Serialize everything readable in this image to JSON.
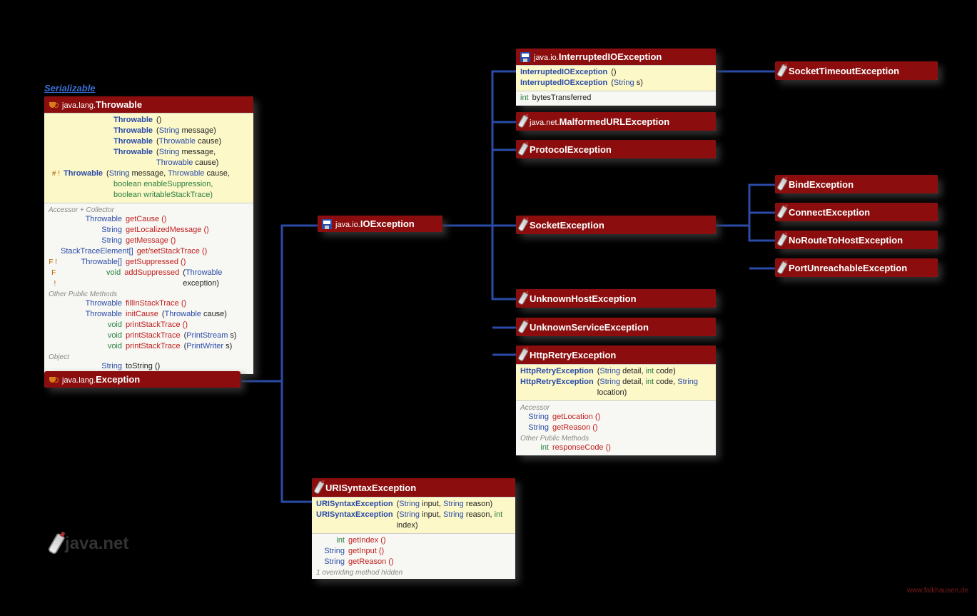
{
  "interfaceLabel": "Serializable",
  "throwable": {
    "pkg": "java.lang.",
    "name": "Throwable",
    "ctors": [
      {
        "name": "Throwable",
        "params": ""
      },
      {
        "name": "Throwable",
        "params": "(String message)"
      },
      {
        "name": "Throwable",
        "params": "(Throwable cause)"
      },
      {
        "name": "Throwable",
        "params": "(String message, Throwable cause)"
      }
    ],
    "protCtor": {
      "mod": "# !",
      "name": "Throwable",
      "p1": "(String message, Throwable cause,",
      "b1": "boolean enableSuppression,",
      "b2": "boolean writableStackTrace)"
    },
    "sec1": "Accessor + Collector",
    "accessors": [
      {
        "ret": "Throwable",
        "m": "getCause ()"
      },
      {
        "ret": "String",
        "m": "getLocalizedMessage ()"
      },
      {
        "ret": "String",
        "m": "getMessage ()"
      },
      {
        "ret": "StackTraceElement[]",
        "m": "get/setStackTrace ()"
      },
      {
        "mod": "F !",
        "ret": "Throwable[]",
        "m": "getSuppressed ()"
      },
      {
        "mod": "F !",
        "ret": "void",
        "m": "addSuppressed (Throwable exception)"
      }
    ],
    "sec2": "Other Public Methods",
    "others": [
      {
        "ret": "Throwable",
        "m": "fillInStackTrace ()"
      },
      {
        "ret": "Throwable",
        "m": "initCause (Throwable cause)"
      },
      {
        "ret": "void",
        "m": "printStackTrace ()"
      },
      {
        "ret": "void",
        "m": "printStackTrace (PrintStream s)"
      },
      {
        "ret": "void",
        "m": "printStackTrace (PrintWriter s)"
      }
    ],
    "sec3": "Object",
    "objm": {
      "ret": "String",
      "m": "toString ()"
    }
  },
  "exception": {
    "pkg": "java.lang.",
    "name": "Exception"
  },
  "ioexception": {
    "pkg": "java.io.",
    "name": "IOException"
  },
  "urisyntax": {
    "name": "URISyntaxException",
    "ctors": [
      {
        "name": "URISyntaxException",
        "p": "(String input, String reason)"
      },
      {
        "name": "URISyntaxException",
        "p": "(String input, String reason, int index)"
      }
    ],
    "acc": [
      {
        "ret": "int",
        "m": "getIndex ()"
      },
      {
        "ret": "String",
        "m": "getInput ()"
      },
      {
        "ret": "String",
        "m": "getReason ()"
      }
    ],
    "note": "1 overriding method hidden"
  },
  "interruptedIO": {
    "pkg": "java.io.",
    "name": "InterruptedIOException",
    "ctors": [
      {
        "name": "InterruptedIOException",
        "p": "()"
      },
      {
        "name": "InterruptedIOException",
        "p": "(String s)"
      }
    ],
    "field": {
      "type": "int",
      "name": "bytesTransferred"
    }
  },
  "malformedURL": {
    "pkg": "java.net.",
    "name": "MalformedURLException"
  },
  "protocol": {
    "name": "ProtocolException"
  },
  "socket": {
    "name": "SocketException"
  },
  "unknownHost": {
    "name": "UnknownHostException"
  },
  "unknownService": {
    "name": "UnknownServiceException"
  },
  "httpRetry": {
    "name": "HttpRetryException",
    "ctors": [
      {
        "name": "HttpRetryException",
        "p": "(String detail, int code)"
      },
      {
        "name": "HttpRetryException",
        "p": "(String detail, int code, String location)"
      }
    ],
    "secA": "Accessor",
    "acc": [
      {
        "ret": "String",
        "m": "getLocation ()"
      },
      {
        "ret": "String",
        "m": "getReason ()"
      }
    ],
    "secO": "Other Public Methods",
    "other": {
      "ret": "int",
      "m": "responseCode ()"
    }
  },
  "socketTimeout": {
    "name": "SocketTimeoutException"
  },
  "bind": {
    "name": "BindException"
  },
  "connect": {
    "name": "ConnectException"
  },
  "noRoute": {
    "name": "NoRouteToHostException"
  },
  "portUnreach": {
    "name": "PortUnreachableException"
  },
  "logo": "java.net",
  "credit": "www.falkhausen.de"
}
